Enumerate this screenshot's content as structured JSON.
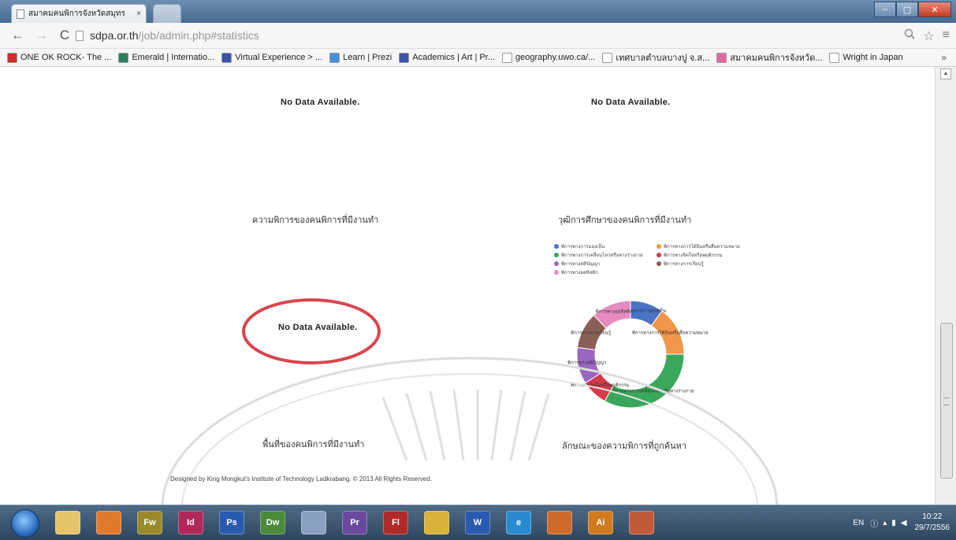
{
  "browser": {
    "tab_title": "สมาคมคนพิการจังหวัดสมุทร",
    "tab_close": "×",
    "url_host": "sdpa.or.th",
    "url_path": "/job/admin.php#statistics",
    "window_buttons": [
      "–",
      "▢",
      "✕"
    ],
    "bookmarks": [
      {
        "label": "ONE OK ROCK- The ...",
        "color": "#d12b2b"
      },
      {
        "label": "Emerald | Internatio...",
        "color": "#2f7d5b"
      },
      {
        "label": "Virtual Experience > ...",
        "color": "#3a54a8"
      },
      {
        "label": "Learn | Prezi",
        "color": "#4a90d9"
      },
      {
        "label": "Academics | Art | Pr...",
        "color": "#3a54a8"
      },
      {
        "label": "geography.uwo.ca/...",
        "color": "#ffffff"
      },
      {
        "label": "เทศบาลตำบลบางปู จ.ส...",
        "color": "#ffffff"
      },
      {
        "label": "สมาคมคนพิการจังหวัด...",
        "color": "#e06aa0"
      },
      {
        "label": "Wright in Japan",
        "color": "#ffffff"
      }
    ],
    "bookmarks_more": "»"
  },
  "page": {
    "nodata_top_left": "No Data Available.",
    "nodata_top_right": "No Data Available.",
    "nodata_middle": "No Data Available.",
    "title_disability": "ความพิการของคนพิการที่มีงานทำ",
    "title_education": "วุฒิการศึกษาของคนพิการที่มีงานทำ",
    "title_area": "พื้นที่ของคนพิการที่มีงานทำ",
    "title_characteristics": "ลักษณะของความพิการที่ถูกค้นหา",
    "footer": "Designed by King Mongkut's Institute of Technology Ladkrabang. © 2013 All Rights Reserved."
  },
  "chart_data": {
    "type": "pie",
    "title": "วุฒิการศึกษาของคนพิการที่มีงานทำ",
    "legend_position": "top",
    "categories": [
      "พิการทางการมองเห็น",
      "พิการทางการได้ยินหรือสื่อความหมาย",
      "พิการทางการเคลื่อนไหวหรือทางร่างกาย",
      "พิการทางจิตใจหรือพฤติกรรม",
      "พิการทางสติปัญญา",
      "พิการทางการเรียนรู้",
      "พิการทางออทิสติก"
    ],
    "values": [
      10,
      15,
      33,
      8,
      11,
      11,
      12
    ],
    "colors": [
      "#4a73c5",
      "#f0974a",
      "#3aa85a",
      "#d43a4a",
      "#9a66c0",
      "#8a6056",
      "#e58bc0"
    ]
  },
  "taskbar": {
    "apps": [
      {
        "name": "explorer",
        "label": "",
        "color": "#e6c46a"
      },
      {
        "name": "media",
        "label": "",
        "color": "#e07a2a"
      },
      {
        "name": "fireworks",
        "label": "Fw",
        "color": "#9a8a2a"
      },
      {
        "name": "indesign",
        "label": "Id",
        "color": "#b0285a"
      },
      {
        "name": "photoshop",
        "label": "Ps",
        "color": "#2a5ab0"
      },
      {
        "name": "dreamweaver",
        "label": "Dw",
        "color": "#4a8a3a"
      },
      {
        "name": "tools",
        "label": "",
        "color": "#8aa0c0"
      },
      {
        "name": "premiere",
        "label": "Pr",
        "color": "#6a4aa0"
      },
      {
        "name": "flash",
        "label": "Fl",
        "color": "#b02a2a"
      },
      {
        "name": "chrome",
        "label": "",
        "color": "#d8b23a"
      },
      {
        "name": "word",
        "label": "W",
        "color": "#2a5ab0"
      },
      {
        "name": "ie",
        "label": "e",
        "color": "#2a8ad0"
      },
      {
        "name": "firefox",
        "label": "",
        "color": "#d06a2a"
      },
      {
        "name": "illustrator",
        "label": "Ai",
        "color": "#d07a20"
      },
      {
        "name": "app",
        "label": "",
        "color": "#c05a3a"
      }
    ],
    "lang": "EN",
    "time": "10:22",
    "date": "29/7/2556"
  }
}
